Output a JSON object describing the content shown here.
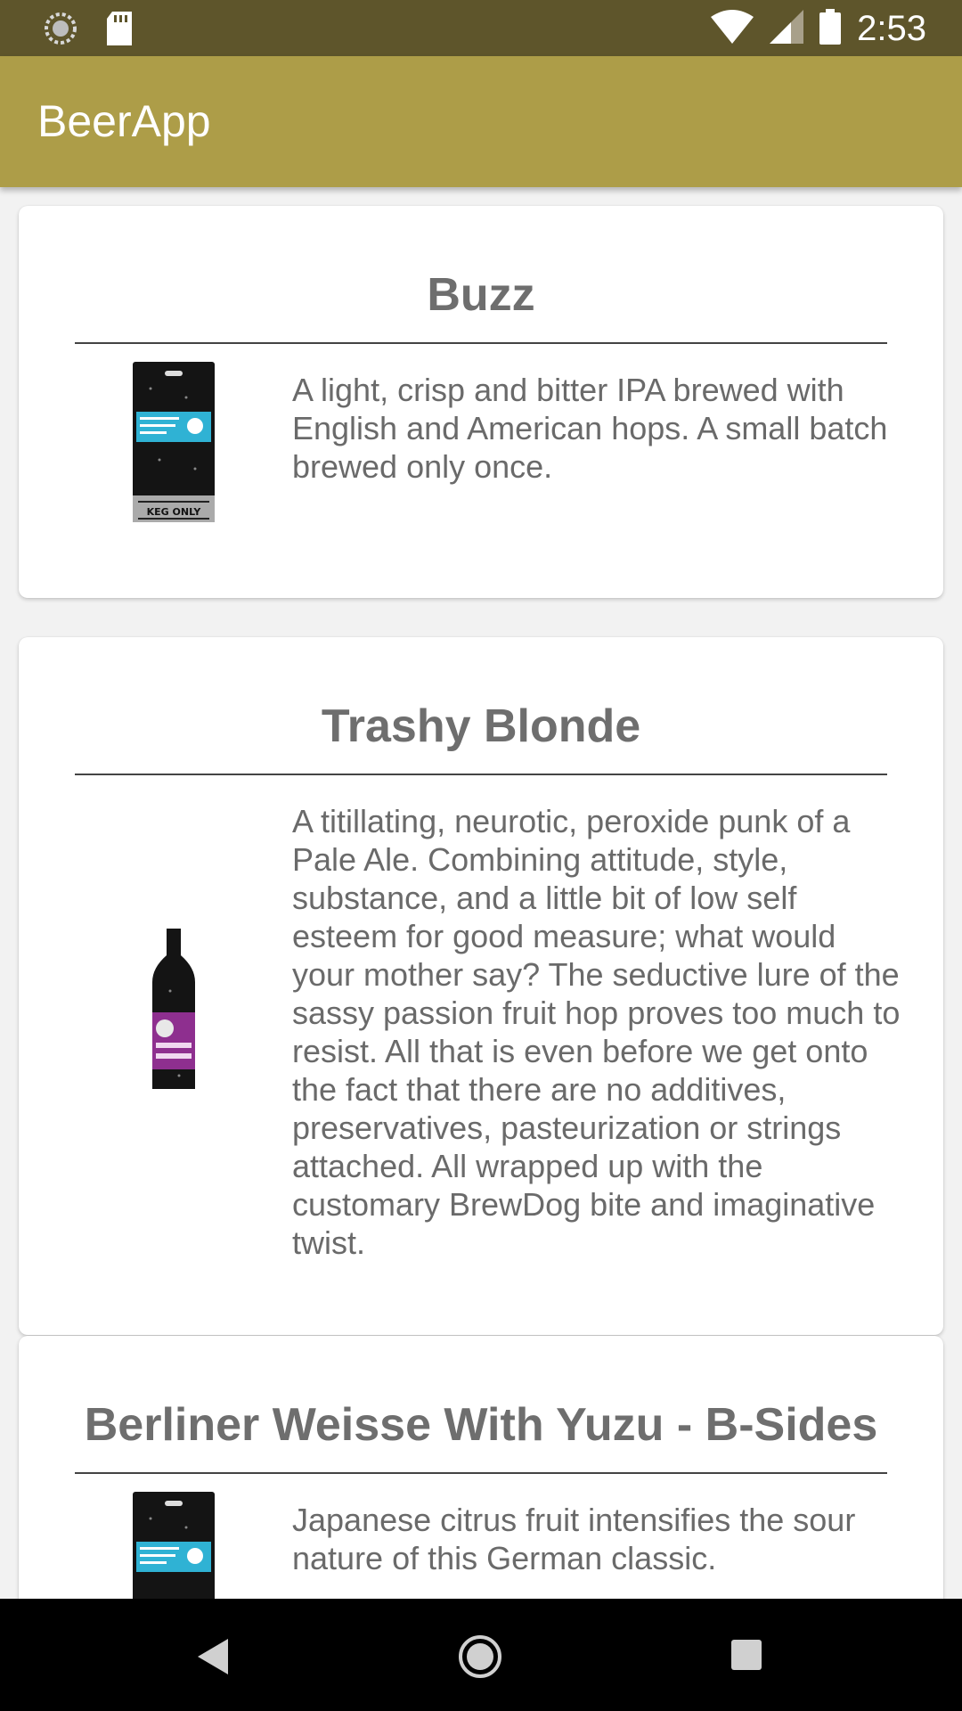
{
  "status_bar": {
    "time": "2:53",
    "left_icons": [
      "loading-spinner-icon",
      "sd-card-icon"
    ],
    "right_icons": [
      "wifi-icon",
      "signal-icon",
      "battery-icon"
    ]
  },
  "app_bar": {
    "title": "BeerApp"
  },
  "beers": [
    {
      "name": "Buzz",
      "description": "A light, crisp and bitter IPA brewed with English and American hops. A small batch brewed only once.",
      "image_label": "KEG ONLY"
    },
    {
      "name": "Trashy Blonde",
      "description": "A titillating, neurotic, peroxide punk of a Pale Ale. Combining attitude, style, substance, and a little bit of low self esteem for good measure; what would your mother say? The seductive lure of the sassy passion fruit hop proves too much to resist. All that is even before we get onto the fact that there are no additives, preservatives, pasteurization or strings attached. All wrapped up with the customary BrewDog bite and imaginative twist."
    },
    {
      "name": "Berliner Weisse With Yuzu - B-Sides",
      "description": "Japanese citrus fruit intensifies the sour nature of this German classic."
    }
  ],
  "nav_bar": {
    "buttons": [
      "back-icon",
      "home-icon",
      "recents-icon"
    ]
  },
  "colors": {
    "status_bar": "#5e552b",
    "app_bar": "#ad9d48",
    "title_text": "#6e6e6e",
    "body_text": "#6a6a6a"
  }
}
